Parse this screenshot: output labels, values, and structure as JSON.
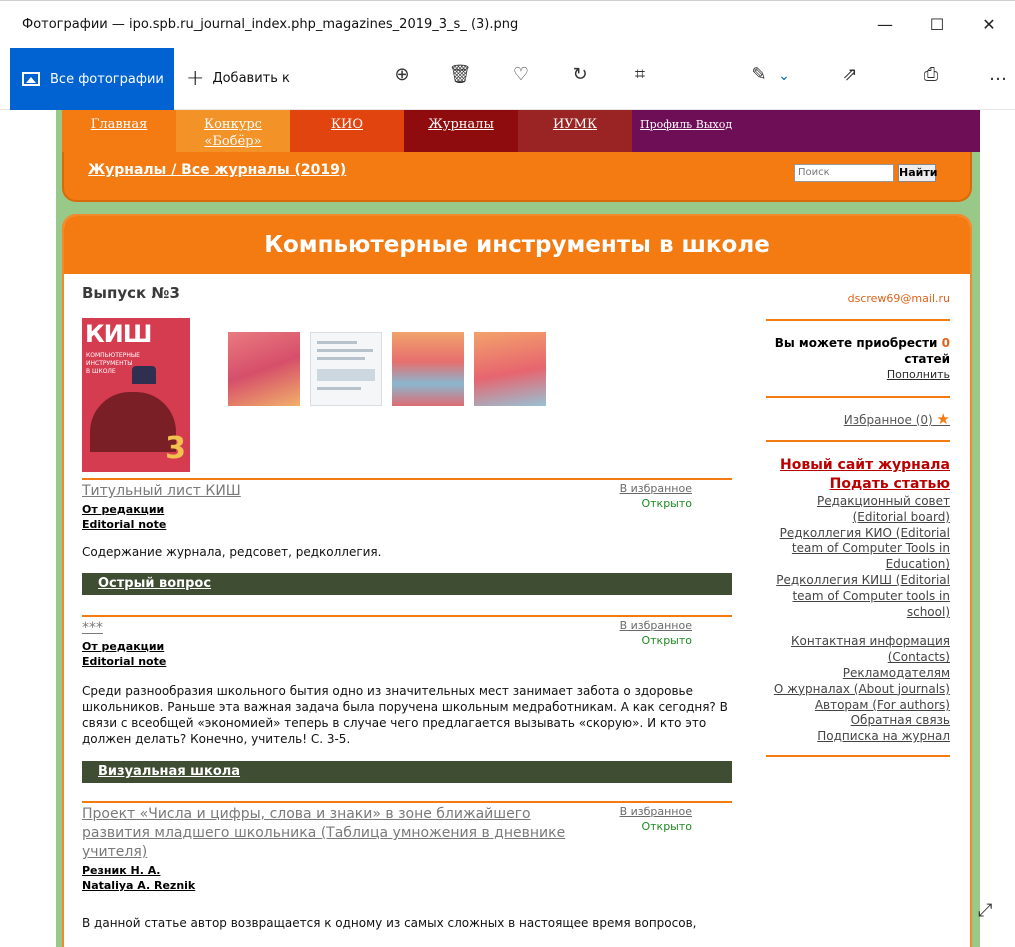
{
  "window": {
    "title": "Фотографии — ipo.spb.ru_journal_index.php_magazines_2019_3_s_ (3).png",
    "minimize": "—",
    "maximize": "☐",
    "close": "✕"
  },
  "toolbar": {
    "all_photos": "Все фотографии",
    "add_to": "Добавить к",
    "icons": [
      "zoom-in-icon",
      "delete-icon",
      "favorite-icon",
      "rotate-icon",
      "crop-icon",
      "edit-icon",
      "share-icon",
      "print-icon",
      "more-icon"
    ],
    "zoom": "⊕",
    "delete": "🗑",
    "heart": "♡",
    "rotate": "↻",
    "crop": "⌗",
    "edit": "✎",
    "chev": "⌄",
    "share": "⇗",
    "print": "⎙",
    "more": "…"
  },
  "nav": {
    "items": [
      {
        "label": "Главная",
        "color": "#f47a12"
      },
      {
        "label": "Конкурс «Бобёр»",
        "color": "#f39226"
      },
      {
        "label": "КИО",
        "color": "#e2440f"
      },
      {
        "label": "Журналы",
        "color": "#8e0c0e"
      },
      {
        "label": "ИУМК",
        "color": "#9a2323"
      }
    ],
    "profile": "Профиль",
    "logout": "Выход",
    "profile_bg": "#6e0e57"
  },
  "crumb": {
    "text": "Журналы / Все журналы (2019)",
    "search_placeholder": "Поиск",
    "find": "Найти"
  },
  "page": {
    "title": "Компьютерные инструменты в школе",
    "issue": "Выпуск №3",
    "cover_title": "КИШ",
    "cover_sub": "КОМПЬЮТЕРНЫЕ ИНСТРУМЕНТЫ В ШКОЛЕ",
    "cover_num": "3"
  },
  "articles": [
    {
      "title": "Титульный лист КИШ",
      "fav": "В избранное",
      "status": "Открыто",
      "authors": [
        "От редакции",
        "Editorial note"
      ],
      "text": "Содержание журнала, редсовет, редколлегия."
    },
    {
      "title": "***",
      "fav": "В избранное",
      "status": "Открыто",
      "authors": [
        "От редакции",
        "Editorial note"
      ],
      "text": "Среди разнообразия школьного бытия одно из значительных мест занимает забота о здоровье школьников. Раньше эта важная задача была поручена школьным медработникам. А как сегодня? В связи с всеобщей «экономией» теперь в случае чего предлагается вызывать «скорую». И кто это должен делать? Конечно, учитель! С. 3-5."
    },
    {
      "title": "Проект «Числа и цифры, слова и знаки» в зоне ближайшего развития младшего школьника (Таблица умножения в дневнике учителя)",
      "fav": "В избранное",
      "status": "Открыто",
      "authors": [
        "Резник Н. А.",
        "Nataliya A. Reznik"
      ],
      "text": "В данной статье автор возвращается к одному из самых сложных в настоящее время вопросов,"
    }
  ],
  "sections": [
    "Острый вопрос",
    "Визуальная школа"
  ],
  "sidebar": {
    "email": "dscrew69@mail.ru",
    "buy_text": "Вы можете приобрести",
    "buy_count": "0",
    "buy_unit": "статей",
    "topup": "Пополнить",
    "favorites": "Избранное (0)",
    "star": "★",
    "new_site": "Новый сайт журнала",
    "submit": "Подать статью",
    "links_a": [
      "Редакционный совет (Editorial board)",
      "Редколлегия КИО (Editorial team of Computer Tools in Education)",
      "Редколлегия КИШ (Editorial team of Computer tools in school)"
    ],
    "links_b": [
      "Контактная информация (Contacts)",
      "Рекламодателям",
      "О журналах (About journals)",
      "Авторам (For authors)",
      "Обратная связь",
      "Подписка на журнал"
    ]
  },
  "colors": {
    "orange": "#f47a12",
    "green_bg": "#98c989",
    "section_band": "#3f4d33",
    "accent_blue": "#0063d1"
  }
}
